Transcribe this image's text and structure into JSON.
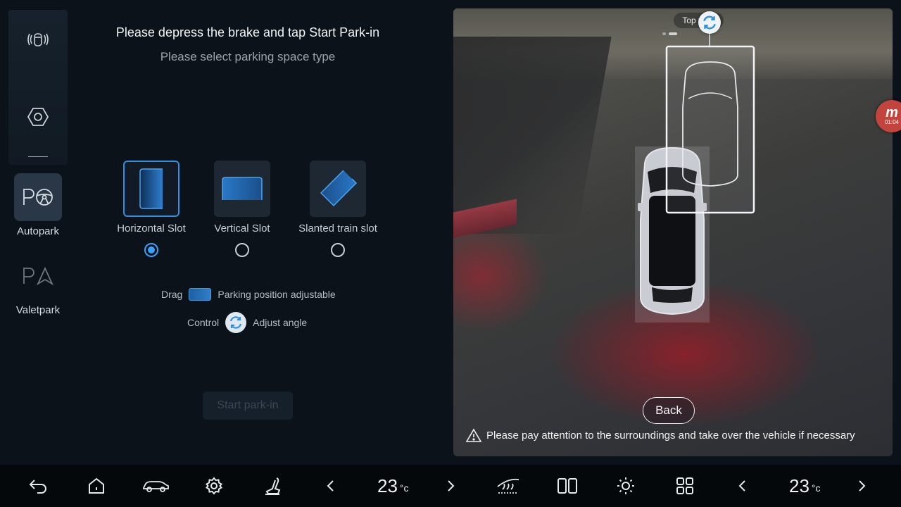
{
  "colors": {
    "background": "#0b121a",
    "accent": "#3aa0ff",
    "selected_border": "#2f8fe0",
    "bottom_bar": "#05080b"
  },
  "sidebar": {
    "items": [
      {
        "icon": "car-sensor-icon",
        "label": ""
      },
      {
        "icon": "hexagon-icon",
        "label": ""
      },
      {
        "icon": "autopark-icon",
        "label": "Autopark",
        "active": true
      },
      {
        "icon": "valetpark-icon",
        "label": "Valetpark"
      }
    ]
  },
  "main": {
    "title": "Please depress the brake and tap Start Park-in",
    "subtitle": "Please select parking space type",
    "slot_types": [
      {
        "label": "Horizontal Slot",
        "selected": true
      },
      {
        "label": "Vertical Slot",
        "selected": false
      },
      {
        "label": "Slanted train slot",
        "selected": false
      }
    ],
    "hints": {
      "drag_prefix": "Drag",
      "drag_text": "Parking position adjustable",
      "control_prefix": "Control",
      "control_text": "Adjust angle"
    },
    "start_button": "Start park-in"
  },
  "camera": {
    "top_view_label": "Top view",
    "back_button": "Back",
    "warning": "Please pay attention to the surroundings and take over the vehicle if necessary"
  },
  "overlay_badge": {
    "letter": "m",
    "time": "01:04"
  },
  "bottom_bar": {
    "left_temp": {
      "value": "23",
      "unit": "°c"
    },
    "right_temp": {
      "value": "23",
      "unit": "°c"
    },
    "icons": [
      "back-icon",
      "home-icon",
      "car-icon",
      "settings-icon",
      "seat-icon",
      "chevron-left-icon",
      "chevron-right-icon",
      "windshield-icon",
      "split-screen-icon",
      "brightness-icon",
      "apps-grid-icon",
      "chevron-left-icon",
      "chevron-right-icon"
    ]
  }
}
